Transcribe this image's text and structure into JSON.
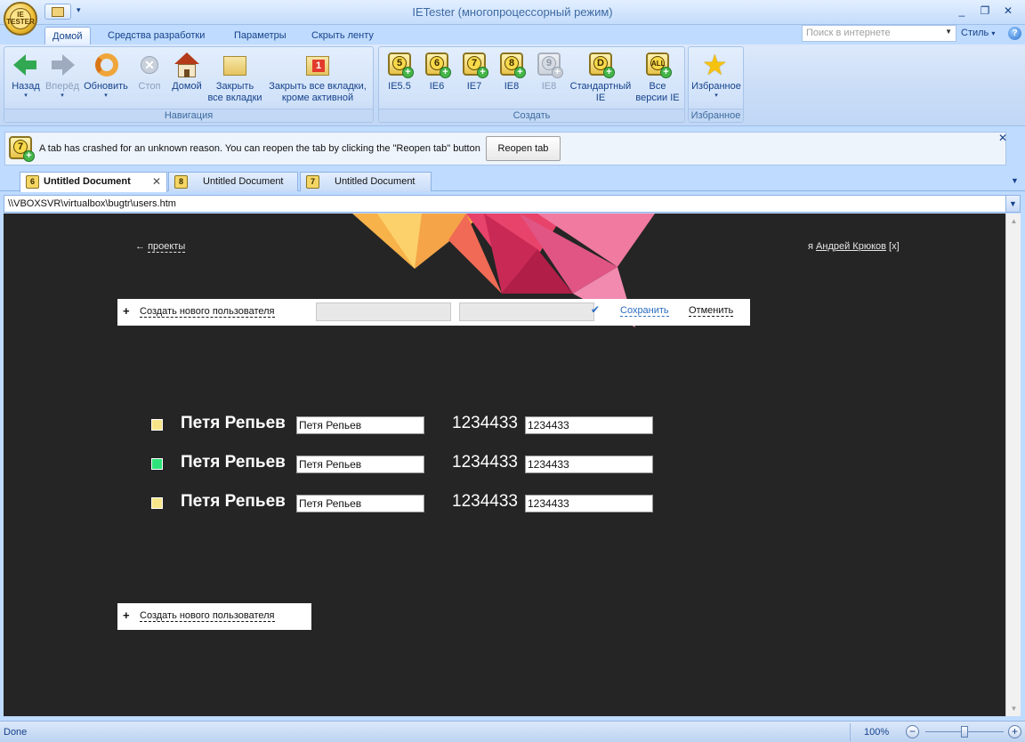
{
  "window": {
    "title": "IETester (многопроцессорный режим)",
    "orb_label": "IE TESTER",
    "buttons": [
      "_",
      "❐",
      "✕"
    ]
  },
  "ribbon_tabs": [
    "Домой",
    "Средства разработки",
    "Параметры",
    "Скрыть ленту"
  ],
  "search": {
    "placeholder": "Поиск в интернете"
  },
  "style_label": "Стиль",
  "groups": {
    "navigation": {
      "label": "Навигация",
      "back": "Назад",
      "forward": "Вперёд",
      "refresh": "Обновить",
      "stop": "Стоп",
      "home": "Домой",
      "close_all_1": "Закрыть",
      "close_all_2": "все вкладки",
      "close_others_1": "Закрыть все вкладки,",
      "close_others_2": "кроме активной",
      "close_others_num": "1"
    },
    "create": {
      "label": "Создать",
      "ie55": "IE5.5",
      "ie6": "IE6",
      "ie7": "IE7",
      "ie8": "IE8",
      "ie8b": "IE8",
      "std_1": "Стандартный",
      "std_2": "IE",
      "all_1": "Все",
      "all_2": "версии IE",
      "badge_55": "5",
      "badge_6": "6",
      "badge_7": "7",
      "badge_8": "8",
      "badge_9": "9",
      "badge_d": "D",
      "badge_all": "ALL"
    },
    "favorites": {
      "label": "Избранное",
      "button": "Избранное"
    }
  },
  "notification": {
    "text": "A tab has crashed for an unknown reason. You can reopen the tab by clicking the \"Reopen tab\" button",
    "button": "Reopen tab",
    "badge": "7"
  },
  "tabs": [
    {
      "label": "Untitled Document",
      "badge": "6"
    },
    {
      "label": "Untitled Document",
      "badge": "8"
    },
    {
      "label": "Untitled Document",
      "badge": "7"
    }
  ],
  "address": "\\\\VBOXSVR\\virtualbox\\bugtr\\users.htm",
  "page": {
    "back_arrow": "←",
    "back_label": "проекты",
    "user_prefix": "я",
    "user_name": "Андрей Крюков",
    "logout": "[x]",
    "create_label": "Создать нового пользователя",
    "save": "Сохранить",
    "cancel": "Отменить",
    "users": [
      {
        "name": "Петя Репьев",
        "phone": "1234433",
        "color": "#f7e58a"
      },
      {
        "name": "Петя Репьев",
        "phone": "1234433",
        "color": "#2ee37a"
      },
      {
        "name": "Петя Репьев",
        "phone": "1234433",
        "color": "#f7e58a"
      }
    ]
  },
  "status": {
    "text": "Done",
    "zoom": "100%"
  }
}
